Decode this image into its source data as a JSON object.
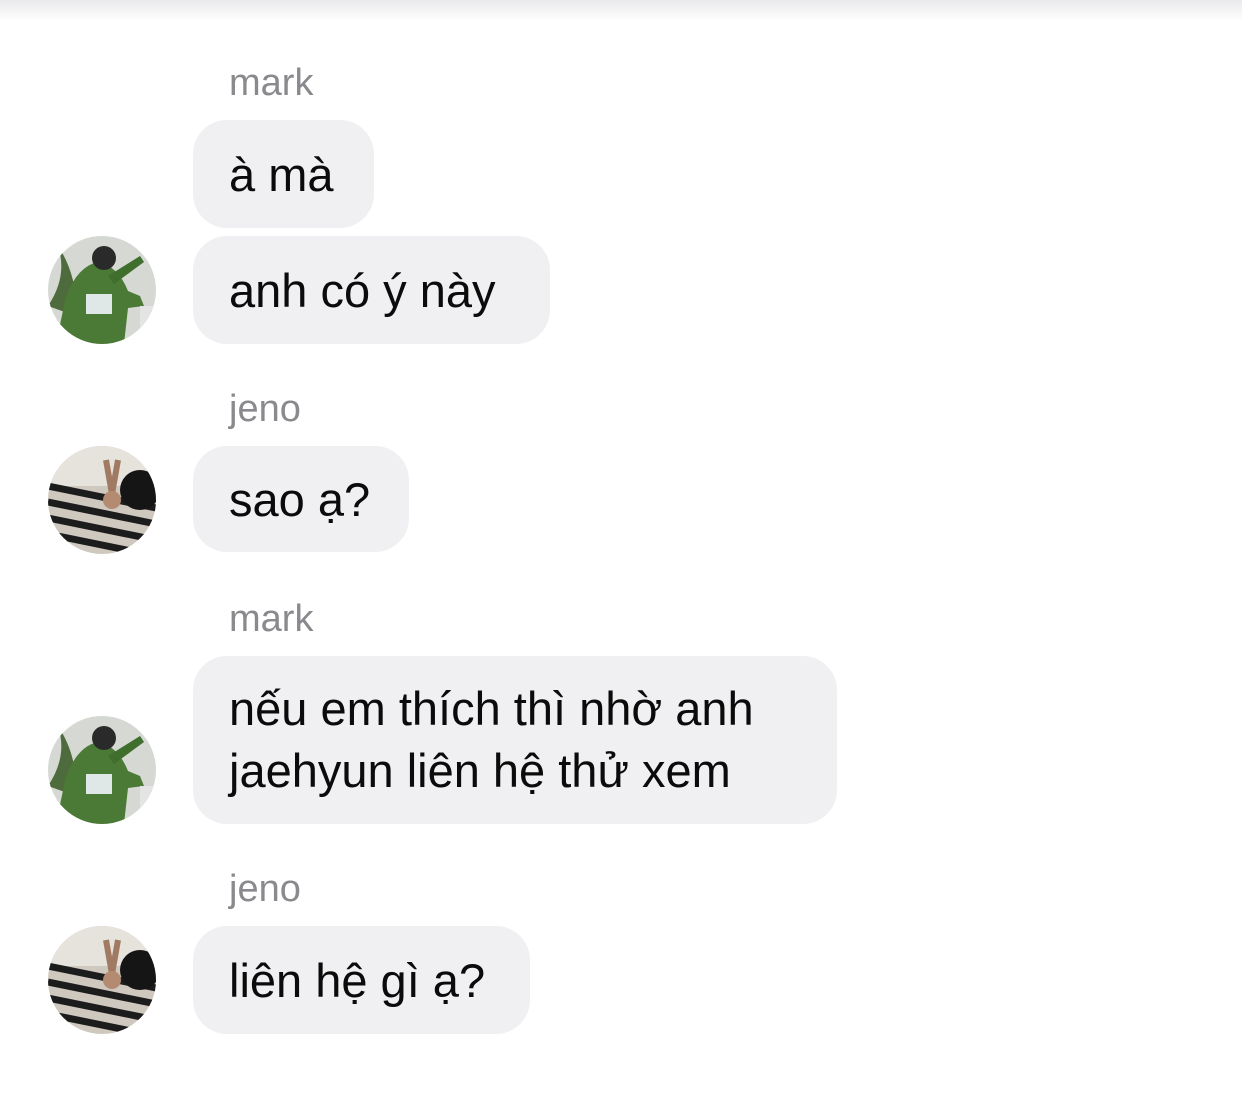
{
  "messages": [
    {
      "sender": "mark",
      "text": "à mà"
    },
    {
      "text": "anh có ý này"
    },
    {
      "sender": "jeno",
      "text": "sao ạ?"
    },
    {
      "sender": "mark",
      "lines": [
        "nếu em thích thì nhờ anh",
        "jaehyun liên hệ thử xem"
      ]
    },
    {
      "sender": "jeno",
      "text": "liên hệ gì ạ?"
    }
  ],
  "colors": {
    "bubble": "#f0f0f2",
    "sender_name": "#8a8a8e",
    "text": "#0b0b0b"
  }
}
